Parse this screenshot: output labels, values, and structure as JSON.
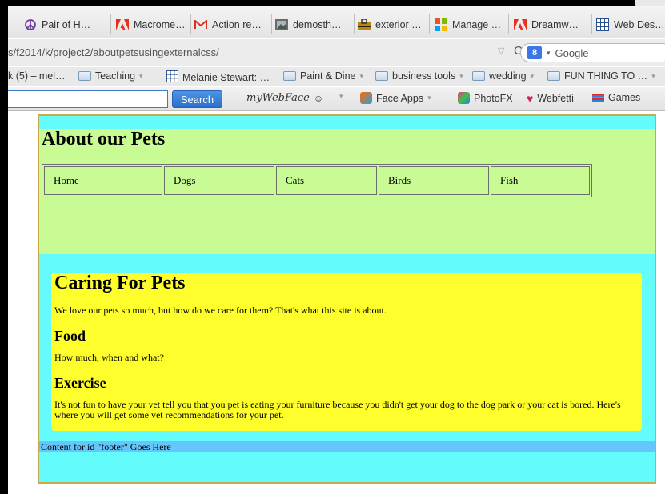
{
  "tabs": [
    {
      "label": "Pair of H…",
      "icon": "peace-icon"
    },
    {
      "label": "Macrome…",
      "icon": "adobe-icon"
    },
    {
      "label": "Action re…",
      "icon": "gmail-icon"
    },
    {
      "label": "demosth…",
      "icon": "image-icon"
    },
    {
      "label": "exterior …",
      "icon": "shop-icon"
    },
    {
      "label": "Manage …",
      "icon": "grid-icon"
    },
    {
      "label": "Dreamw…",
      "icon": "adobe-icon"
    },
    {
      "label": "Web Des…",
      "icon": "table-icon"
    }
  ],
  "address_bar": {
    "url": "s/f2014/k/project2/aboutpetsusingexternalcss/",
    "search_engine": "Google"
  },
  "bookmarks": [
    {
      "label": "k (5) – mel…",
      "has_caret": false
    },
    {
      "label": "Teaching",
      "has_caret": true
    },
    {
      "label": "Melanie Stewart: …",
      "has_caret": false
    },
    {
      "label": "Paint & Dine",
      "has_caret": true
    },
    {
      "label": "business tools",
      "has_caret": true
    },
    {
      "label": "wedding",
      "has_caret": true
    },
    {
      "label": "FUN THING TO …",
      "has_caret": true
    }
  ],
  "toolbar": {
    "search_button": "Search",
    "brand": "myWebFace",
    "items": [
      "Face Apps",
      "PhotoFX",
      "Webfetti",
      "Games"
    ]
  },
  "page": {
    "header_title": "About our Pets",
    "nav": [
      "Home",
      "Dogs",
      "Cats",
      "Birds",
      "Fish"
    ],
    "main_title": "Caring For Pets",
    "intro": "We love our pets so much, but how do we care for them? That's what this site is about.",
    "food_heading": "Food",
    "food_text": "How much, when and what?",
    "exercise_heading": "Exercise",
    "exercise_text": "It's not fun to have your vet tell you that you pet is eating your furniture because you didn't get your dog to the dog park or your cat is bored. Here's where you will get some vet recommendations for your pet.",
    "footer": "Content for id \"footer\" Goes Here"
  },
  "colors": {
    "container_bg": "#63fbfb",
    "header_bg": "#c9fb94",
    "main_bg": "#fefe2c",
    "footer_bg": "#63c7fb"
  }
}
